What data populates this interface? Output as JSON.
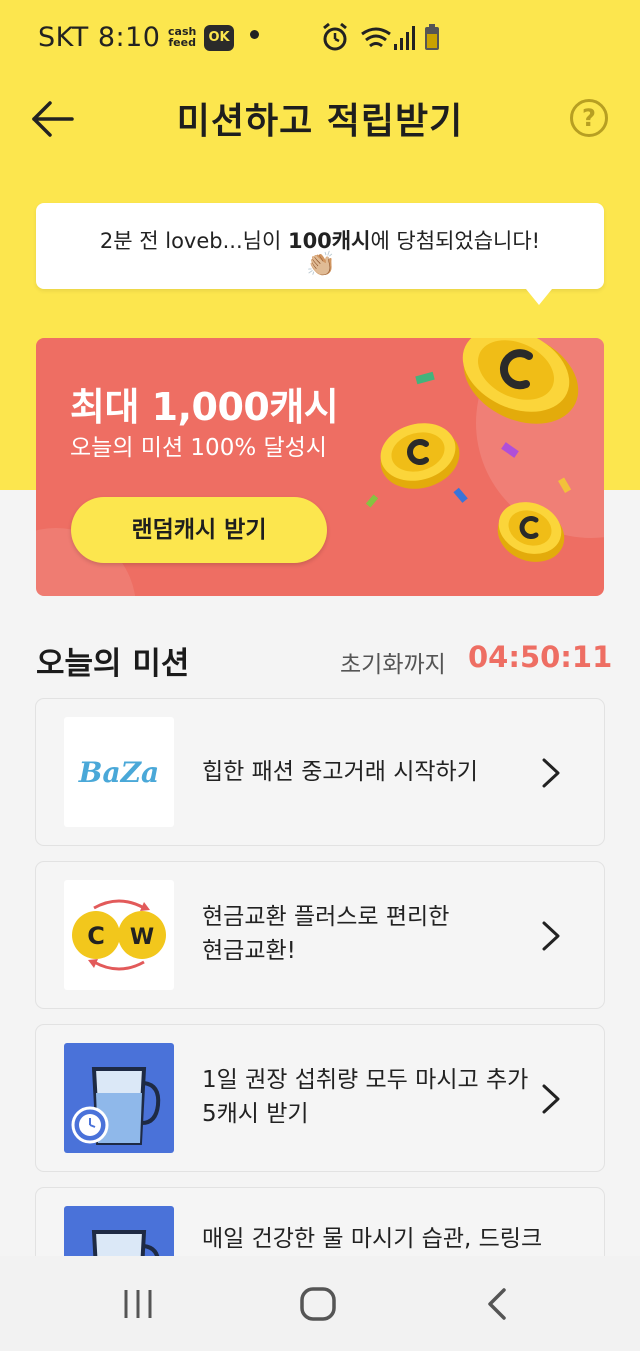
{
  "status_bar": {
    "carrier_time": "SKT 8:10",
    "cashfeed_badge": "cash feed",
    "ok_badge": "OK",
    "icons": [
      "alarm-icon",
      "wifi-icon",
      "signal-icon",
      "battery-icon"
    ]
  },
  "header": {
    "title": "미션하고 적립받기",
    "help_label": "?"
  },
  "toast": {
    "prefix": "2분 전 loveb...님이 ",
    "amount": "100캐시",
    "suffix": "에 당첨되었습니다!",
    "emoji": "👏🏼"
  },
  "promo": {
    "headline": "최대 1,000캐시",
    "subline": "오늘의 미션 100% 달성시",
    "button_label": "랜덤캐시 받기"
  },
  "missions_section": {
    "title": "오늘의 미션",
    "reset_label": "초기화까지",
    "reset_time": "04:50:11"
  },
  "missions": [
    {
      "thumb_logo_text": "BaZa",
      "line1": "힙한 패션 중고거래 시작하기",
      "line2": ""
    },
    {
      "thumb_logo_text": "C W",
      "line1": "현금교환 플러스로 편리한",
      "line2": "현금교환!"
    },
    {
      "thumb_logo_text": "",
      "line1": "1일 권장 섭취량 모두 마시고 추가",
      "line2": "5캐시 받기"
    },
    {
      "thumb_logo_text": "",
      "line1": "매일 건강한 물 마시기 습관, 드링크",
      "line2": ""
    }
  ],
  "colors": {
    "brand_yellow": "#fce64e",
    "promo_red": "#ee6e63",
    "timer_red": "#ee6e63",
    "mission_blue": "#4a72d9"
  }
}
